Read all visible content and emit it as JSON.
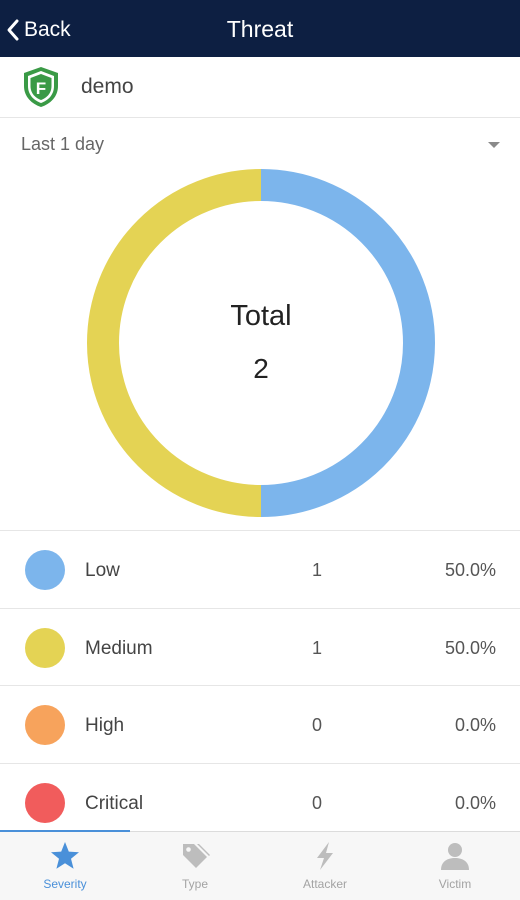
{
  "nav": {
    "back_label": "Back",
    "title": "Threat"
  },
  "device": {
    "name": "demo",
    "logo_letter": "F",
    "logo_color": "#3a9a46"
  },
  "period": {
    "selected": "Last 1 day"
  },
  "center": {
    "title": "Total",
    "value": "2"
  },
  "chart_data": {
    "type": "pie",
    "title": "",
    "categories": [
      "Low",
      "Medium",
      "High",
      "Critical"
    ],
    "values": [
      1,
      1,
      0,
      0
    ],
    "total": 2,
    "colors": [
      "#7cb5ec",
      "#e4d354",
      "#f7a35c",
      "#f15c5c"
    ]
  },
  "legend": [
    {
      "label": "Low",
      "count": "1",
      "percent": "50.0%",
      "color": "#7cb5ec"
    },
    {
      "label": "Medium",
      "count": "1",
      "percent": "50.0%",
      "color": "#e4d354"
    },
    {
      "label": "High",
      "count": "0",
      "percent": "0.0%",
      "color": "#f7a35c"
    },
    {
      "label": "Critical",
      "count": "0",
      "percent": "0.0%",
      "color": "#f15c5c"
    }
  ],
  "tabs": [
    {
      "label": "Severity",
      "icon": "star-icon",
      "active": true
    },
    {
      "label": "Type",
      "icon": "tag-icon",
      "active": false
    },
    {
      "label": "Attacker",
      "icon": "lightning-icon",
      "active": false
    },
    {
      "label": "Victim",
      "icon": "person-icon",
      "active": false
    }
  ],
  "colors": {
    "nav_bg": "#0d1f42",
    "accent": "#4a90d9",
    "inactive_tab": "#a3a3a3"
  }
}
